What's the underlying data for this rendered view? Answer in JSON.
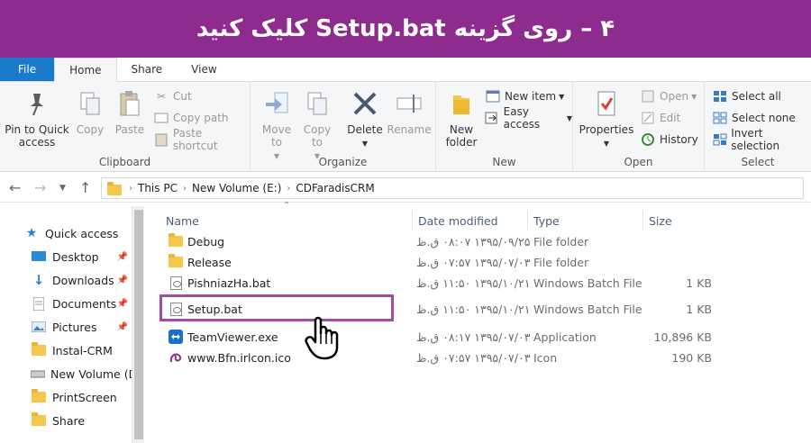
{
  "banner": {
    "title": "۴ – روی گزینه Setup.bat  کلیک کنید"
  },
  "tabs": {
    "file": "File",
    "home": "Home",
    "share": "Share",
    "view": "View"
  },
  "ribbon": {
    "clipboard": {
      "label": "Clipboard",
      "pin": "Pin to Quick access",
      "copy": "Copy",
      "paste": "Paste",
      "cut": "Cut",
      "copy_path": "Copy path",
      "paste_shortcut": "Paste shortcut"
    },
    "organize": {
      "label": "Organize",
      "move_to": "Move to",
      "copy_to": "Copy to",
      "delete": "Delete",
      "rename": "Rename"
    },
    "new": {
      "label": "New",
      "new_folder": "New folder",
      "new_item": "New item",
      "easy_access": "Easy access"
    },
    "open": {
      "label": "Open",
      "properties": "Properties",
      "open": "Open",
      "edit": "Edit",
      "history": "History"
    },
    "select": {
      "label": "Select",
      "select_all": "Select all",
      "select_none": "Select none",
      "invert": "Invert selection"
    }
  },
  "address": {
    "this_pc": "This PC",
    "volume": "New Volume (E:)",
    "folder": "CDFaradisCRM"
  },
  "nav": {
    "quick_access": "Quick access",
    "items": [
      "Desktop",
      "Downloads",
      "Documents",
      "Pictures",
      "Instal-CRM",
      "New Volume (D",
      "PrintScreen",
      "Share"
    ]
  },
  "columns": {
    "name": "Name",
    "date": "Date modified",
    "type": "Type",
    "size": "Size"
  },
  "files": [
    {
      "name": "Debug",
      "date": "۱۳۹۵/۰۹/۲۵ ۰۸:۰۷ ق.ظ",
      "type": "File folder",
      "size": "",
      "icon": "folder-icon"
    },
    {
      "name": "Release",
      "date": "۱۳۹۵/۰۷/۰۳ ۰۷:۵۷ ق.ظ",
      "type": "File folder",
      "size": "",
      "icon": "folder-icon"
    },
    {
      "name": "PishniazHa.bat",
      "date": "۱۳۹۵/۱۰/۲۱ ۱۱:۵۰ ق.ظ",
      "type": "Windows Batch File",
      "size": "1 KB",
      "icon": "batch-file-icon"
    },
    {
      "name": "Setup.bat",
      "date": "۱۳۹۵/۱۰/۲۱ ۱۱:۵۰ ق.ظ",
      "type": "Windows Batch File",
      "size": "1 KB",
      "icon": "batch-file-icon"
    },
    {
      "name": "TeamViewer.exe",
      "date": "۱۳۹۵/۰۷/۰۳ ۰۸:۱۷ ق.ظ",
      "type": "Application",
      "size": "10,896 KB",
      "icon": "teamviewer-icon"
    },
    {
      "name": "www.Bfn.irlcon.ico",
      "date": "۱۳۹۵/۰۷/۰۳ ۰۷:۵۷ ق.ظ",
      "type": "Icon",
      "size": "190 KB",
      "icon": "ico-file-icon"
    }
  ]
}
